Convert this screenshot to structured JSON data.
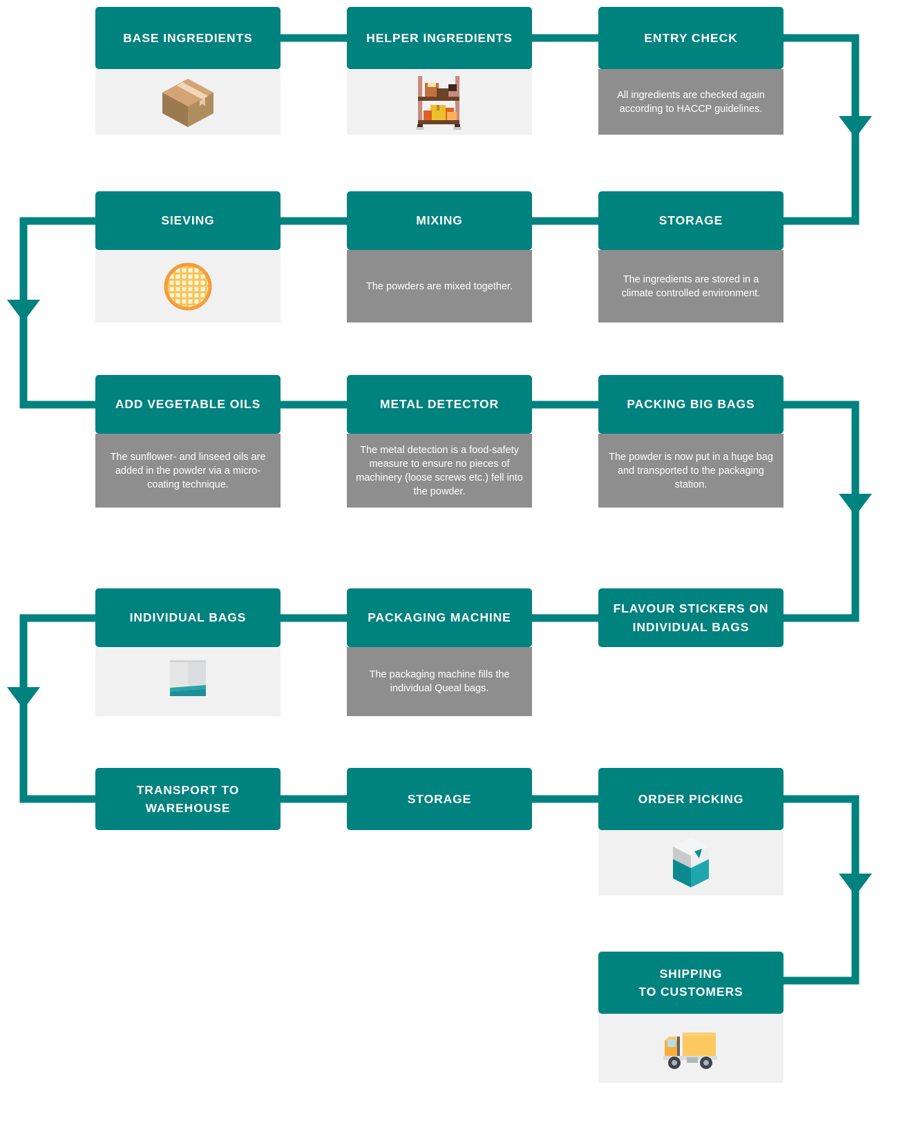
{
  "diagram": {
    "title": "Queal Production Process Flowchart",
    "colors": {
      "header_teal": "#00827f",
      "body_gray": "#8e8e8e",
      "icon_panel": "#f1f1f1",
      "connector": "#00827f",
      "text_white": "#ffffff"
    },
    "nodes": [
      {
        "id": "base-ingredients",
        "title": "BASE INGREDIENTS",
        "body_type": "icon",
        "icon": "cardboard-box-icon",
        "description": ""
      },
      {
        "id": "helper-ingredients",
        "title": "HELPER INGREDIENTS",
        "body_type": "icon",
        "icon": "storage-shelf-icon",
        "description": ""
      },
      {
        "id": "entry-check",
        "title": "ENTRY CHECK",
        "body_type": "text",
        "icon": "",
        "description": "All ingredients are checked again according to HACCP guidelines."
      },
      {
        "id": "sieving",
        "title": "SIEVING",
        "body_type": "icon",
        "icon": "sieve-mesh-icon",
        "description": ""
      },
      {
        "id": "mixing",
        "title": "MIXING",
        "body_type": "text",
        "icon": "",
        "description": "The powders are mixed together."
      },
      {
        "id": "storage-1",
        "title": "STORAGE",
        "body_type": "text",
        "icon": "",
        "description": "The ingredients are stored in a climate controlled environment."
      },
      {
        "id": "add-vegetable-oils",
        "title": "ADD VEGETABLE OILS",
        "body_type": "text",
        "icon": "",
        "description": "The sunflower- and linseed oils are added in the powder via a micro-coating technique."
      },
      {
        "id": "metal-detector",
        "title": "METAL DETECTOR",
        "body_type": "text",
        "icon": "",
        "description": "The metal detection is a food-safety measure to ensure no pieces of machinery (loose screws etc.) fell into the powder."
      },
      {
        "id": "packing-big-bags",
        "title": "PACKING BIG BAGS",
        "body_type": "text",
        "icon": "",
        "description": "The powder is now put in a huge bag and transported to the packaging station."
      },
      {
        "id": "individual-bags",
        "title": "INDIVIDUAL BAGS",
        "body_type": "icon",
        "icon": "queal-pouch-icon",
        "description": ""
      },
      {
        "id": "packaging-machine",
        "title": "PACKAGING MACHINE",
        "body_type": "text",
        "icon": "",
        "description": "The packaging machine fills the individual Queal bags."
      },
      {
        "id": "flavour-stickers",
        "title": "FLAVOUR STICKERS ON INDIVIDUAL BAGS",
        "title_line1": "FLAVOUR STICKERS ON",
        "title_line2": "INDIVIDUAL BAGS",
        "body_type": "none",
        "icon": "",
        "description": ""
      },
      {
        "id": "transport-to-warehouse",
        "title": "TRANSPORT TO WAREHOUSE",
        "title_line1": "TRANSPORT TO",
        "title_line2": "WAREHOUSE",
        "body_type": "none",
        "icon": "",
        "description": ""
      },
      {
        "id": "storage-2",
        "title": "STORAGE",
        "body_type": "none",
        "icon": "",
        "description": ""
      },
      {
        "id": "order-picking",
        "title": "ORDER PICKING",
        "body_type": "icon",
        "icon": "queal-box-icon",
        "description": ""
      },
      {
        "id": "shipping-to-customers",
        "title": "SHIPPING TO CUSTOMERS",
        "title_line1": "SHIPPING",
        "title_line2": "TO CUSTOMERS",
        "body_type": "icon",
        "icon": "delivery-truck-icon",
        "description": ""
      }
    ],
    "flow_order": [
      "BASE INGREDIENTS",
      "HELPER INGREDIENTS",
      "ENTRY CHECK",
      "STORAGE",
      "MIXING",
      "SIEVING",
      "ADD VEGETABLE OILS",
      "METAL DETECTOR",
      "PACKING BIG BAGS",
      "FLAVOUR STICKERS ON INDIVIDUAL BAGS",
      "PACKAGING MACHINE",
      "INDIVIDUAL BAGS",
      "TRANSPORT TO WAREHOUSE",
      "STORAGE",
      "ORDER PICKING",
      "SHIPPING TO CUSTOMERS"
    ]
  }
}
